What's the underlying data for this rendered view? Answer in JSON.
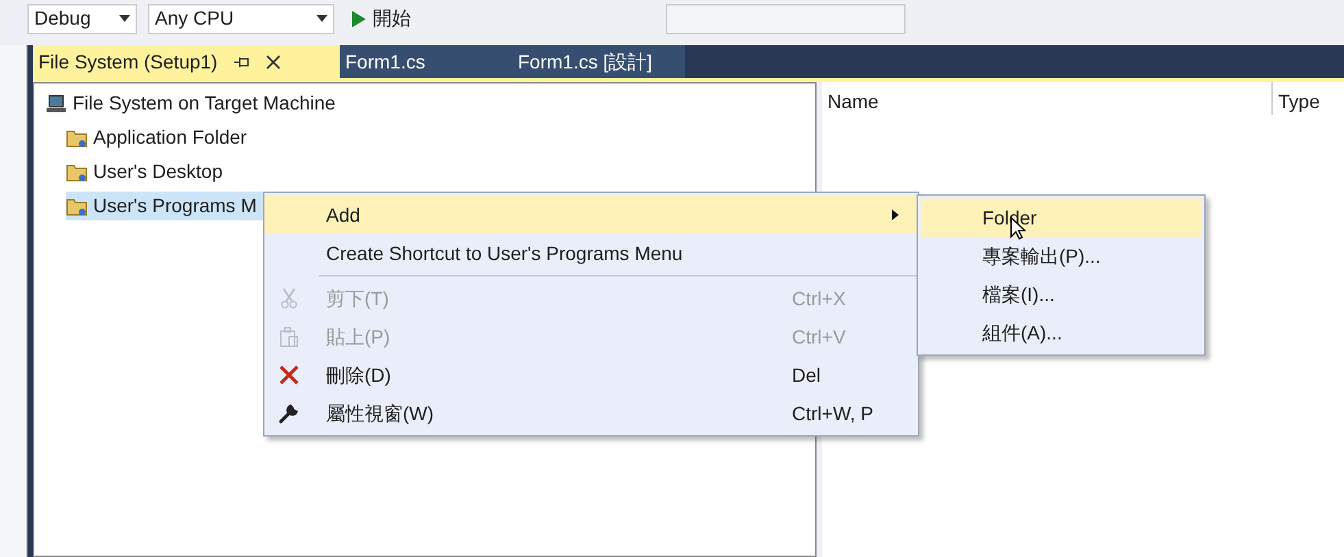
{
  "toolbar": {
    "configuration": "Debug",
    "platform": "Any CPU",
    "start_label": "開始"
  },
  "tabs": [
    {
      "label": "File System (Setup1)",
      "selected": true
    },
    {
      "label": "Form1.cs",
      "selected": false
    },
    {
      "label": "Form1.cs [設計]",
      "selected": false
    }
  ],
  "tree": {
    "label": "File System on Target Machine",
    "children": [
      {
        "label": "Application Folder",
        "selected": false
      },
      {
        "label": "User's Desktop",
        "selected": false
      },
      {
        "label": "User's Programs M",
        "selected": true
      }
    ]
  },
  "columns": [
    "Name",
    "Type"
  ],
  "context_menu": [
    {
      "kind": "submenu",
      "label": "Add",
      "highlighted": true,
      "disabled": false
    },
    {
      "kind": "item",
      "label": "Create Shortcut to User's Programs Menu",
      "highlighted": false,
      "disabled": false
    },
    {
      "kind": "separator"
    },
    {
      "kind": "item",
      "label": "剪下(T)",
      "shortcut": "Ctrl+X",
      "highlighted": false,
      "disabled": true
    },
    {
      "kind": "item",
      "label": "貼上(P)",
      "shortcut": "Ctrl+V",
      "highlighted": false,
      "disabled": true
    },
    {
      "kind": "item",
      "label": "刪除(D)",
      "shortcut": "Del",
      "highlighted": false,
      "disabled": false
    },
    {
      "kind": "item",
      "label": "屬性視窗(W)",
      "shortcut": "Ctrl+W, P",
      "highlighted": false,
      "disabled": false
    }
  ],
  "submenu": [
    {
      "label": "Folder",
      "highlighted": true
    },
    {
      "label": "專案輸出(P)...",
      "highlighted": false
    },
    {
      "label": "檔案(I)...",
      "highlighted": false
    },
    {
      "label": "組件(A)...",
      "highlighted": false
    }
  ]
}
